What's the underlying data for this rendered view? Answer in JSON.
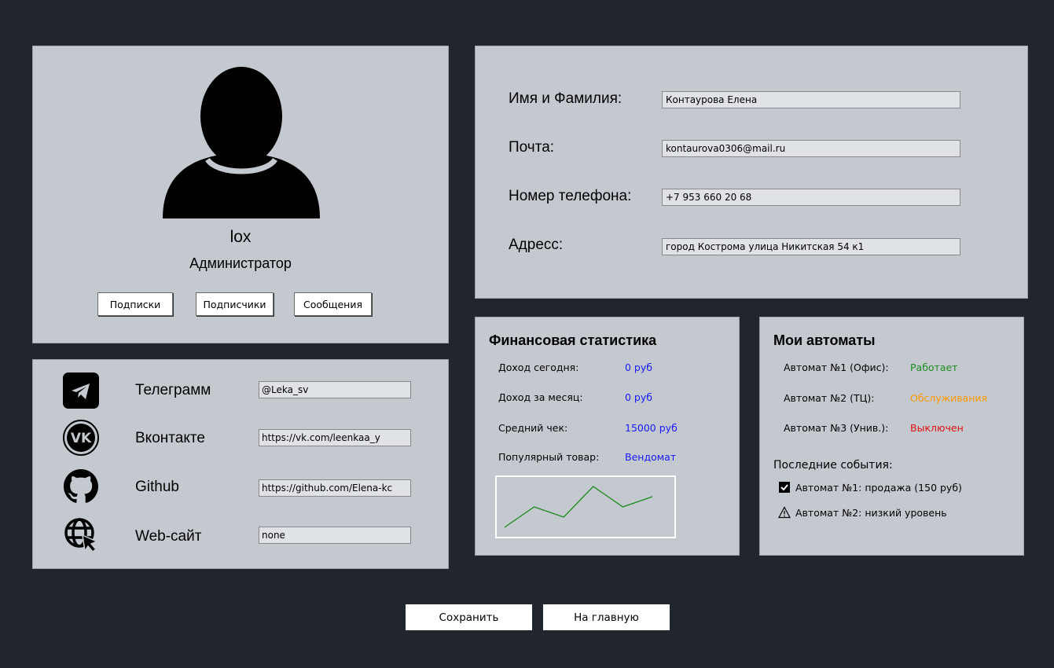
{
  "profile": {
    "name": "lox",
    "role": "Администратор",
    "buttons": {
      "subscriptions": "Подписки",
      "subscribers": "Подписчики",
      "messages": "Сообщения"
    }
  },
  "info": {
    "fields": [
      {
        "label": "Имя и Фамилия:",
        "value": "Контаурова Елена"
      },
      {
        "label": "Почта:",
        "value": "kontaurova0306@mail.ru"
      },
      {
        "label": "Номер телефона:",
        "value": "+7 953 660 20 68"
      },
      {
        "label": "Адресс:",
        "value": "город Кострома улица Никитская 54 к1"
      }
    ]
  },
  "social": {
    "items": [
      {
        "label": "Телеграмм",
        "value": "@Leka_sv",
        "icon": "telegram-icon"
      },
      {
        "label": "Вконтакте",
        "value": "https://vk.com/leenkaa_y",
        "icon": "vk-icon"
      },
      {
        "label": "Github",
        "value": "https://github.com/Elena-kc",
        "icon": "github-icon"
      },
      {
        "label": "Web-сайт",
        "value": "none",
        "icon": "globe-cursor-icon"
      }
    ]
  },
  "finance": {
    "title": "Финансовая статистика",
    "rows": [
      {
        "label": "Доход сегодня:",
        "value": "0 руб"
      },
      {
        "label": "Доход за месяц:",
        "value": "0 руб"
      },
      {
        "label": "Средний чек:",
        "value": "15000 руб"
      },
      {
        "label": "Популярный товар:",
        "value": "Вендомат"
      }
    ],
    "value_color": "#1a1aff",
    "sparkline": {
      "values": [
        1,
        3,
        2,
        5,
        3,
        4
      ],
      "color": "#1a8a1a"
    }
  },
  "machines": {
    "title": "Мои автоматы",
    "rows": [
      {
        "label": "Автомат №1 (Офис):",
        "status": "Работает",
        "color": "#1e8c1e"
      },
      {
        "label": "Автомат №2 (ТЦ):",
        "status": "Обслуживания",
        "color": "#ff9900"
      },
      {
        "label": "Автомат №3 (Унив.):",
        "status": "Выключен",
        "color": "#e01010"
      }
    ],
    "events_title": "Последние события:",
    "events": [
      {
        "text": "Автомат №1: продажа (150 руб)",
        "icon": "checkbox-checked-icon"
      },
      {
        "text": "Автомат №2: низкий уровень",
        "icon": "warning-icon"
      }
    ]
  },
  "actions": {
    "save": "Сохранить",
    "home": "На главную"
  }
}
